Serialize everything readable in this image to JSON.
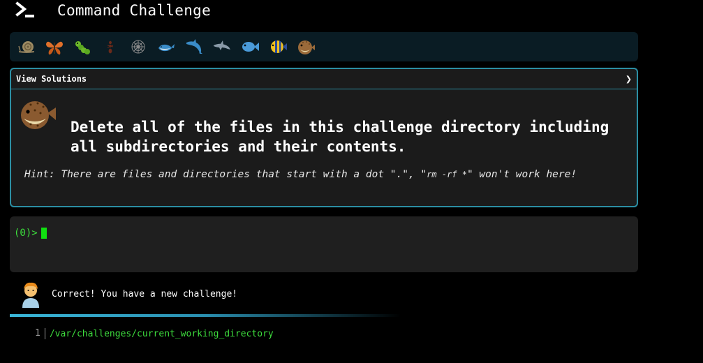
{
  "app": {
    "title": "Command Challenge"
  },
  "levels": [
    {
      "icon": "snail-icon"
    },
    {
      "icon": "butterfly-icon"
    },
    {
      "icon": "caterpillar-icon"
    },
    {
      "icon": "ant-icon"
    },
    {
      "icon": "spider-web-icon"
    },
    {
      "icon": "whale-icon"
    },
    {
      "icon": "dolphin-icon"
    },
    {
      "icon": "dolphin-grey-icon"
    },
    {
      "icon": "fish-icon"
    },
    {
      "icon": "tropical-fish-icon"
    },
    {
      "icon": "blowfish-icon"
    }
  ],
  "challenge": {
    "solutions_label": "View Solutions",
    "chevron": "❯",
    "avatar_icon": "blowfish-icon",
    "task": "Delete all of the files in this challenge directory including all subdirectories and their contents.",
    "hint_prefix": "Hint: There are files and directories that start with a dot \".\", \"",
    "hint_code": "rm -rf *",
    "hint_suffix": "\" won't work here!"
  },
  "terminal": {
    "prompt": "(0)>"
  },
  "feedback": {
    "message": "Correct! You have a new challenge!",
    "avatar_icon": "person-icon"
  },
  "cwd": {
    "line_number": "1",
    "path": "/var/challenges/current_working_directory"
  },
  "colors": {
    "border": "#2b8ea3",
    "prompt_green": "#3ddc3d",
    "cursor_green": "#10e010",
    "bar_blue": "#3ab7d9"
  }
}
